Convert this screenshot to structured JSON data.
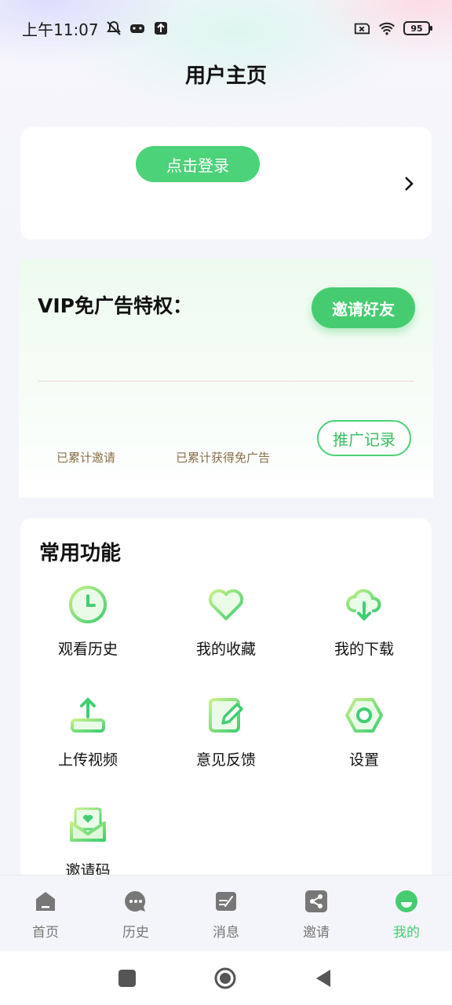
{
  "status_bar": {
    "time": "上午11:07",
    "battery": "95"
  },
  "header": {
    "title": "用户主页"
  },
  "login": {
    "button_label": "点击登录"
  },
  "vip": {
    "title": "VIP免广告特权：",
    "invite_button": "邀请好友",
    "stats": [
      {
        "label": "已累计邀请"
      },
      {
        "label": "已累计获得免广告"
      }
    ],
    "promo_button": "推广记录"
  },
  "functions": {
    "title": "常用功能",
    "items": [
      {
        "label": "观看历史",
        "icon": "clock-icon"
      },
      {
        "label": "我的收藏",
        "icon": "heart-icon"
      },
      {
        "label": "我的下载",
        "icon": "cloud-download-icon"
      },
      {
        "label": "上传视频",
        "icon": "upload-icon"
      },
      {
        "label": "意见反馈",
        "icon": "edit-note-icon"
      },
      {
        "label": "设置",
        "icon": "settings-icon"
      },
      {
        "label": "邀请码",
        "icon": "mail-heart-icon"
      }
    ]
  },
  "tabbar": {
    "tabs": [
      {
        "label": "首页",
        "icon": "home-icon"
      },
      {
        "label": "历史",
        "icon": "chat-dots-icon"
      },
      {
        "label": "消息",
        "icon": "message-icon"
      },
      {
        "label": "邀请",
        "icon": "share-icon"
      },
      {
        "label": "我的",
        "icon": "profile-icon",
        "active": true
      }
    ]
  },
  "colors": {
    "accent": "#46cc70",
    "stat_text": "#8a6e4a",
    "inactive": "#777777"
  }
}
